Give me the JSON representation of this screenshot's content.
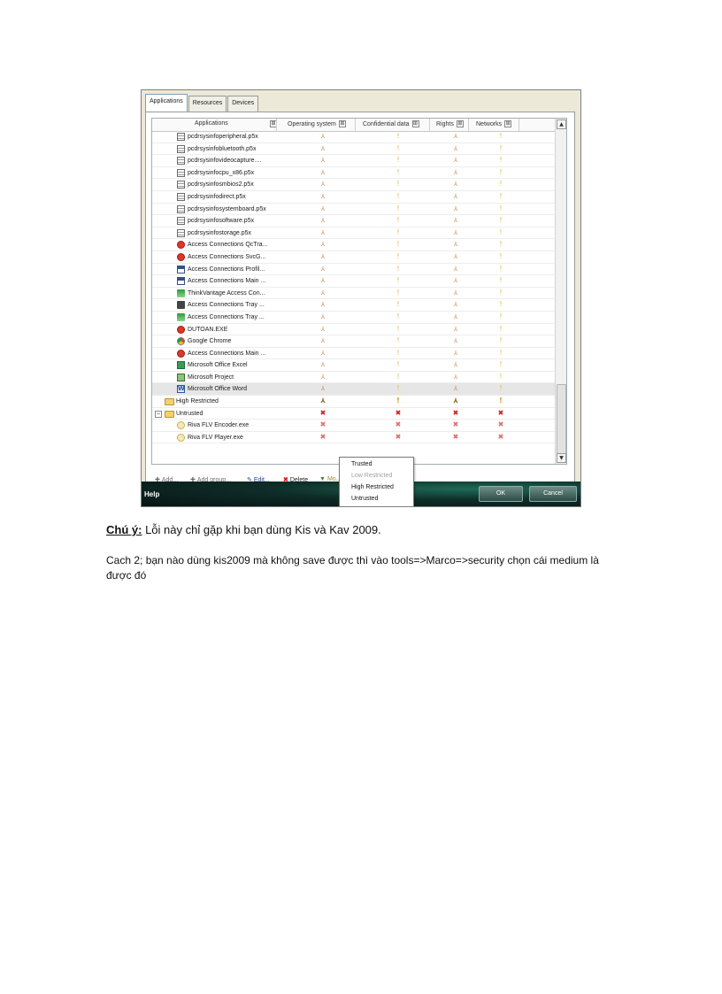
{
  "tabs": [
    {
      "label": "Applications",
      "active": true
    },
    {
      "label": "Resources",
      "active": false
    },
    {
      "label": "Devices",
      "active": false
    }
  ],
  "columns": [
    "Applications",
    "Operating system",
    "Confidential data",
    "Rights",
    "Networks"
  ],
  "header_expand_glyph": "⊞",
  "rows": [
    {
      "label": "pcdrsysinfoperipheral.p5x",
      "icon": "file-icon",
      "marks": [
        "ok",
        "warn",
        "ok",
        "warn"
      ]
    },
    {
      "label": "pcdrsysinfobluetooth.p5x",
      "icon": "file-icon",
      "marks": [
        "ok",
        "warn",
        "ok",
        "warn"
      ]
    },
    {
      "label": "pcdrsysinfovideocapture....",
      "icon": "file-icon",
      "marks": [
        "ok",
        "warn",
        "ok",
        "warn"
      ]
    },
    {
      "label": "pcdrsysinfocpu_x86.p5x",
      "icon": "file-icon",
      "marks": [
        "ok",
        "warn",
        "ok",
        "warn"
      ]
    },
    {
      "label": "pcdrsysinfosmbios2.p5x",
      "icon": "file-icon",
      "marks": [
        "ok",
        "warn",
        "ok",
        "warn"
      ]
    },
    {
      "label": "pcdrsysinfodirect.p5x",
      "icon": "file-icon",
      "marks": [
        "ok",
        "warn",
        "ok",
        "warn"
      ]
    },
    {
      "label": "pcdrsysinfosystemboard.p5x",
      "icon": "file-icon",
      "marks": [
        "ok",
        "warn",
        "ok",
        "warn"
      ]
    },
    {
      "label": "pcdrsysinfosoftware.p5x",
      "icon": "file-icon",
      "marks": [
        "ok",
        "warn",
        "ok",
        "warn"
      ]
    },
    {
      "label": "pcdrsysinfostorage.p5x",
      "icon": "file-icon",
      "marks": [
        "ok",
        "warn",
        "ok",
        "warn"
      ]
    },
    {
      "label": "Access Connections QcTra...",
      "icon": "access-connections-icon",
      "marks": [
        "ok",
        "warn",
        "ok",
        "warn"
      ]
    },
    {
      "label": "Access Connections SvcG...",
      "icon": "access-connections-icon",
      "marks": [
        "ok",
        "warn",
        "ok",
        "warn"
      ]
    },
    {
      "label": "Access Connections Profil...",
      "icon": "window-icon",
      "marks": [
        "ok",
        "warn",
        "ok",
        "warn"
      ]
    },
    {
      "label": "Access Connections Main ...",
      "icon": "window-icon",
      "marks": [
        "ok",
        "warn",
        "ok",
        "warn"
      ]
    },
    {
      "label": "ThinkVantage Access Con...",
      "icon": "antenna-icon",
      "marks": [
        "ok",
        "warn",
        "ok",
        "warn"
      ]
    },
    {
      "label": "Access Connections Tray ...",
      "icon": "tray-icon",
      "marks": [
        "ok",
        "warn",
        "ok",
        "warn"
      ]
    },
    {
      "label": "Access Connections Tray ...",
      "icon": "signal-icon",
      "marks": [
        "ok",
        "warn",
        "ok",
        "warn"
      ]
    },
    {
      "label": "DUTOAN.EXE",
      "icon": "access-connections-icon",
      "marks": [
        "ok",
        "warn",
        "ok",
        "warn"
      ]
    },
    {
      "label": "Google Chrome",
      "icon": "chrome-icon",
      "marks": [
        "ok",
        "warn",
        "ok",
        "warn"
      ]
    },
    {
      "label": "Access Connections Main ...",
      "icon": "access-connections-icon",
      "marks": [
        "ok",
        "warn",
        "ok",
        "warn"
      ]
    },
    {
      "label": "Microsoft Office Excel",
      "icon": "excel-icon",
      "marks": [
        "ok",
        "warn",
        "ok",
        "warn"
      ]
    },
    {
      "label": "Microsoft Project",
      "icon": "project-icon",
      "marks": [
        "ok",
        "warn",
        "ok",
        "warn"
      ]
    },
    {
      "label": "Microsoft Office Word",
      "icon": "word-icon",
      "marks": [
        "ok",
        "warn",
        "ok",
        "warn"
      ],
      "selected": true
    },
    {
      "label": "High Restricted",
      "icon": "folder-icon",
      "group": true,
      "marks": [
        "ok-full",
        "warn-full",
        "ok-full",
        "warn-full"
      ]
    },
    {
      "label": "Untrusted",
      "icon": "folder-icon",
      "group": true,
      "expanded": true,
      "marks": [
        "x",
        "x",
        "x",
        "x"
      ]
    },
    {
      "label": "Riva FLV Encoder.exe",
      "icon": "riva-icon",
      "child": true,
      "marks": [
        "x-light",
        "x-light",
        "x-light",
        "x-light"
      ]
    },
    {
      "label": "Riva FLV Player.exe",
      "icon": "riva-icon",
      "child": true,
      "marks": [
        "x-light",
        "x-light",
        "x-light",
        "x-light"
      ]
    }
  ],
  "glyphs": {
    "ok": "⅄",
    "warn": "!",
    "x": "✖"
  },
  "toolbar": {
    "add": "Add...",
    "add_group": "Add group...",
    "edit": "Edit...",
    "delete": "Delete",
    "move": "Mo..."
  },
  "popup": [
    {
      "label": "Trusted",
      "disabled": false
    },
    {
      "label": "Low Restricted",
      "disabled": true
    },
    {
      "label": "High Restricted",
      "disabled": false
    },
    {
      "label": "Untrusted",
      "disabled": false
    }
  ],
  "footer": {
    "help": "Help",
    "ok": "OK",
    "cancel": "Cancel"
  },
  "note": {
    "label": "Chú ý:",
    "text": " Lỗi này chỉ gặp khi bạn dùng Kis  và Kav 2009."
  },
  "paragraph": "Cach 2; bạn nào dùng kis2009 mà không save được thì vào tools=>Marco=>security  chọn cái medium là được đó"
}
